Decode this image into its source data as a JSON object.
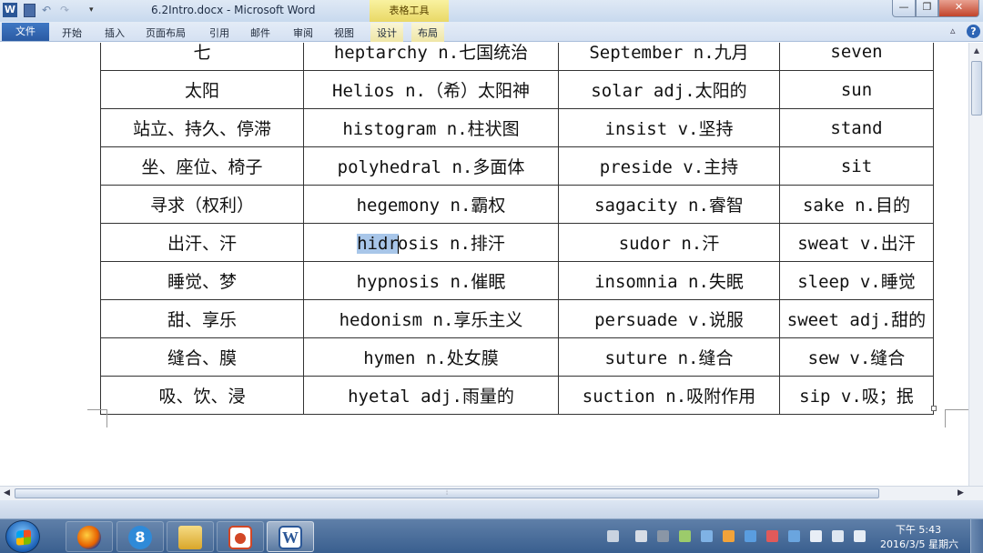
{
  "window": {
    "title": "6.2Intro.docx - Microsoft Word",
    "app_icon": "W",
    "contextual_tab": "表格工具",
    "minimize_label": "—",
    "maximize_label": "❐",
    "close_label": "✕"
  },
  "ribbon": {
    "file_tab": "文件",
    "tabs": [
      "开始",
      "插入",
      "页面布局",
      "引用",
      "邮件",
      "审阅",
      "视图"
    ],
    "context_tabs": [
      "设计",
      "布局"
    ],
    "help": "?",
    "minimize_ribbon": "▵"
  },
  "table": {
    "rows": [
      [
        "七",
        "heptarchy n.七国统治",
        "September n.九月",
        "seven"
      ],
      [
        "太阳",
        "Helios n.（希）太阳神",
        "solar adj.太阳的",
        "sun"
      ],
      [
        "站立、持久、停滞",
        "histogram n.柱状图",
        "insist v.坚持",
        "stand"
      ],
      [
        "坐、座位、椅子",
        "polyhedral n.多面体",
        "preside v.主持",
        "sit"
      ],
      [
        "寻求（权利）",
        "hegemony n.霸权",
        "sagacity n.睿智",
        "sake n.目的"
      ],
      [
        "出汗、汗",
        "hidrosis n.排汗",
        "sudor n.汗",
        "sweat v.出汗"
      ],
      [
        "睡觉、梦",
        "hypnosis n.催眠",
        "insomnia n.失眠",
        "sleep v.睡觉"
      ],
      [
        "甜、享乐",
        "hedonism n.享乐主义",
        "persuade v.说服",
        "sweet adj.甜的"
      ],
      [
        "缝合、膜",
        "hymen n.处女膜",
        "suture n.缝合",
        "sew v.缝合"
      ],
      [
        "吸、饮、浸",
        "hyetal adj.雨量的",
        "suction n.吸附作用",
        "sip v.吸；抿"
      ]
    ],
    "selection": {
      "row": 5,
      "col": 1,
      "selected_text": "hidr",
      "rest_text": "osis n.排汗"
    }
  },
  "taskbar": {
    "apps": [
      "firefox",
      "sogou-browser",
      "file-explorer",
      "powerpoint",
      "word"
    ],
    "sogou_glyph": "8",
    "word_glyph": "W",
    "clock_time": "下午 5:43",
    "clock_date": "2016/3/5 星期六"
  },
  "colors": {
    "selection": "#a8c6e9",
    "title_bar": "#dfe9f5",
    "file_tab": "#2a5aa3",
    "close_button": "#c2432a",
    "taskbar": "#3a5f8f"
  }
}
